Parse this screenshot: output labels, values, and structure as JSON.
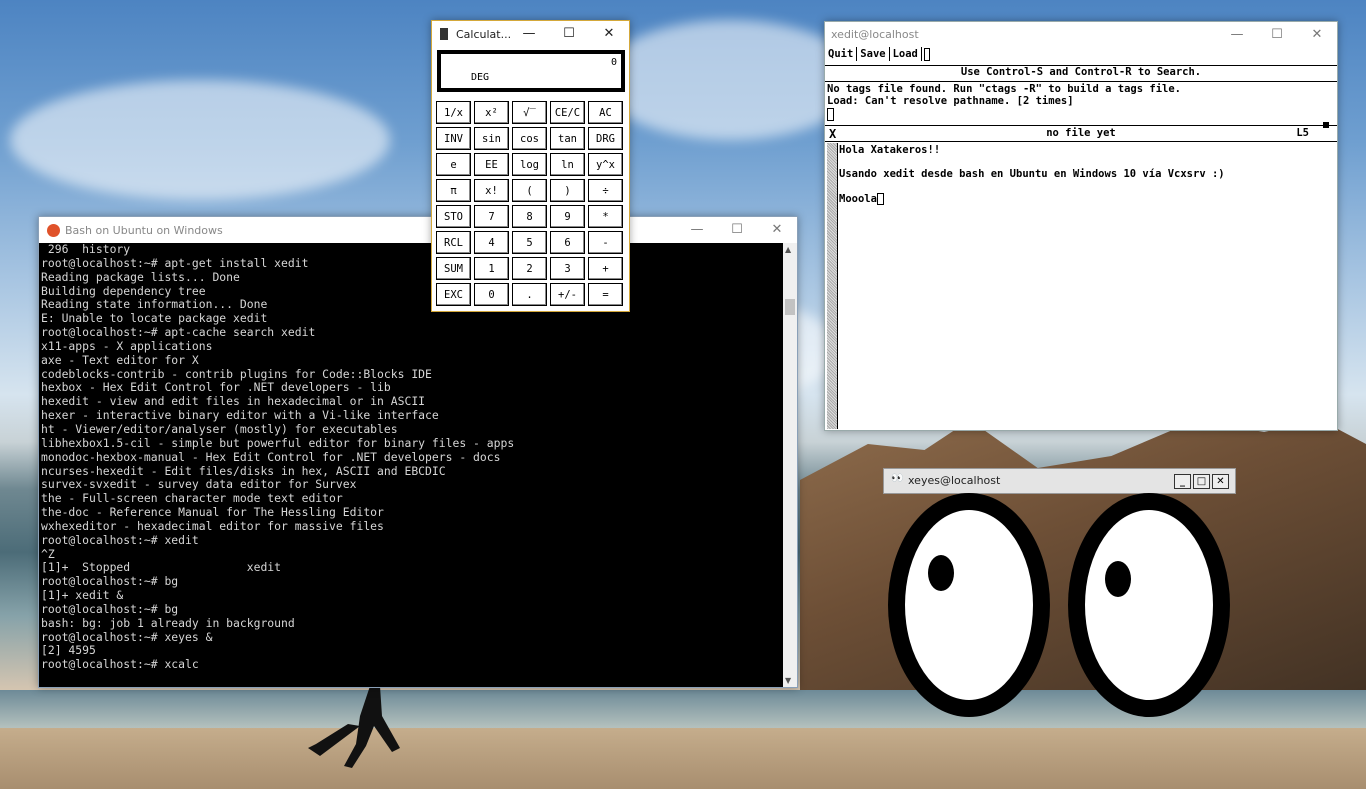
{
  "terminal": {
    "title": "Bash on Ubuntu on Windows",
    "lines": [
      " 296  history",
      "root@localhost:~# apt-get install xedit",
      "Reading package lists... Done",
      "Building dependency tree",
      "Reading state information... Done",
      "E: Unable to locate package xedit",
      "root@localhost:~# apt-cache search xedit",
      "x11-apps - X applications",
      "axe - Text editor for X",
      "codeblocks-contrib - contrib plugins for Code::Blocks IDE",
      "hexbox - Hex Edit Control for .NET developers - lib",
      "hexedit - view and edit files in hexadecimal or in ASCII",
      "hexer - interactive binary editor with a Vi-like interface",
      "ht - Viewer/editor/analyser (mostly) for executables",
      "libhexbox1.5-cil - simple but powerful editor for binary files - apps",
      "monodoc-hexbox-manual - Hex Edit Control for .NET developers - docs",
      "ncurses-hexedit - Edit files/disks in hex, ASCII and EBCDIC",
      "survex-svxedit - survey data editor for Survex",
      "the - Full-screen character mode text editor",
      "the-doc - Reference Manual for The Hessling Editor",
      "wxhexeditor - hexadecimal editor for massive files",
      "root@localhost:~# xedit",
      "^Z",
      "[1]+  Stopped                 xedit",
      "root@localhost:~# bg",
      "[1]+ xedit &",
      "root@localhost:~# bg",
      "bash: bg: job 1 already in background",
      "root@localhost:~# xeyes &",
      "[2] 4595",
      "root@localhost:~# xcalc"
    ]
  },
  "calculator": {
    "title": "Calculat...",
    "display_value": "0",
    "mode": "DEG",
    "keys": [
      "1/x",
      "x²",
      "√‾",
      "CE/C",
      "AC",
      "INV",
      "sin",
      "cos",
      "tan",
      "DRG",
      "e",
      "EE",
      "log",
      "ln",
      "y^x",
      "π",
      "x!",
      "(",
      ")",
      "÷",
      "STO",
      "7",
      "8",
      "9",
      "*",
      "RCL",
      "4",
      "5",
      "6",
      "-",
      "SUM",
      "1",
      "2",
      "3",
      "+",
      "EXC",
      "0",
      ".",
      "+/-",
      "="
    ]
  },
  "xedit": {
    "title": "xedit@localhost",
    "menu": [
      "Quit",
      "Save",
      "Load"
    ],
    "hint": "Use Control-S and Control-R to Search.",
    "messages": "No tags file found. Run \"ctags -R\" to build a tags file.\nLoad: Can't resolve pathname. [2 times]",
    "status_file": "no file yet",
    "status_line": "L5",
    "status_x": "X",
    "text": "Hola Xatakeros!!\n\nUsando xedit desde bash en Ubuntu en Windows 10 vía Vcxsrv :)\n\nMooola"
  },
  "xeyes": {
    "title": "xeyes@localhost"
  },
  "window_controls": {
    "minimize": "—",
    "maximize": "☐",
    "close": "✕"
  }
}
